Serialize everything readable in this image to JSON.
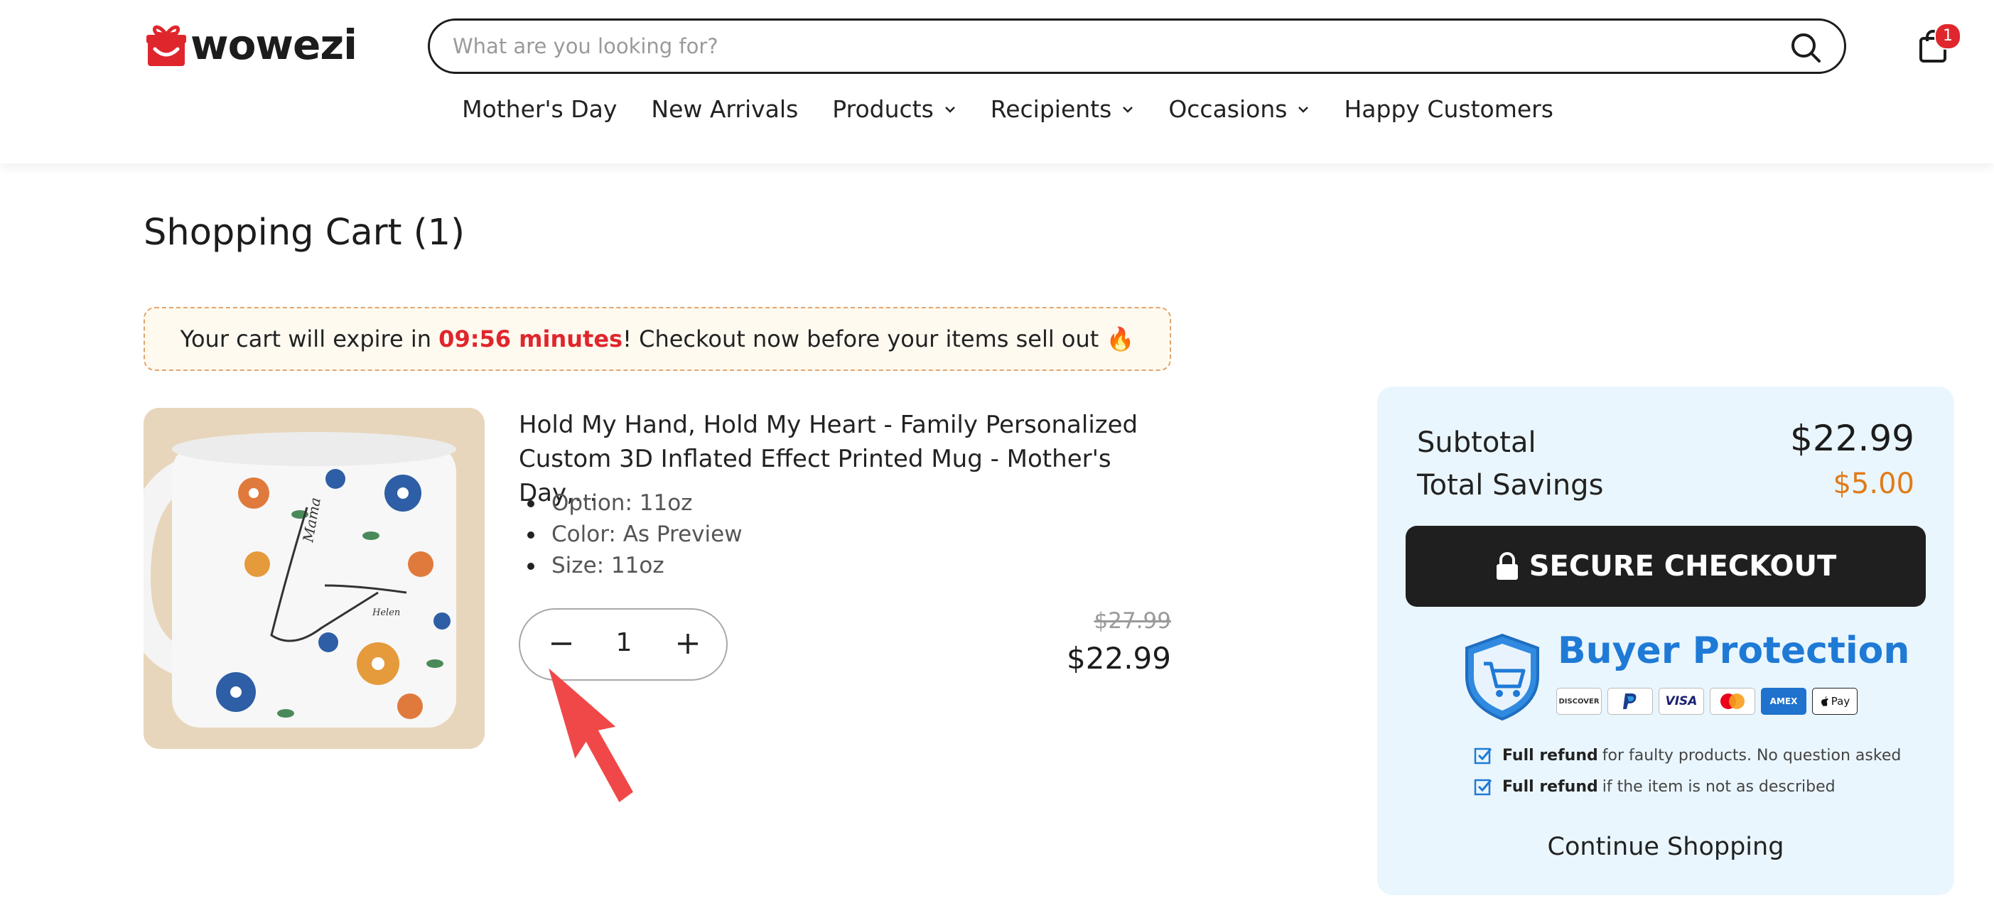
{
  "header": {
    "brand": "wowezi",
    "search_placeholder": "What are you looking for?",
    "cart_count": "1",
    "nav": [
      {
        "label": "Mother's Day",
        "dropdown": false
      },
      {
        "label": "New Arrivals",
        "dropdown": false
      },
      {
        "label": "Products",
        "dropdown": true
      },
      {
        "label": "Recipients",
        "dropdown": true
      },
      {
        "label": "Occasions",
        "dropdown": true
      },
      {
        "label": "Happy Customers",
        "dropdown": false
      }
    ]
  },
  "cart": {
    "title": "Shopping Cart (1)",
    "timer": {
      "prefix": "Your cart will expire in ",
      "time": "09:56 minutes",
      "suffix": "! Checkout now before your items sell out 🔥"
    },
    "item": {
      "title": "Hold My Hand, Hold My Heart - Family Personalized Custom 3D Inflated Effect Printed Mug - Mother's Day,...",
      "options": [
        "Option: 11oz",
        "Color: As Preview",
        "Size: 11oz"
      ],
      "quantity": "1",
      "price_original": "$27.99",
      "price": "$22.99",
      "mug_texts": [
        "Mama",
        "Helen"
      ]
    }
  },
  "summary": {
    "subtotal_label": "Subtotal",
    "subtotal": "$22.99",
    "savings_label": "Total Savings",
    "savings": "$5.00",
    "checkout_label": "SECURE CHECKOUT",
    "protection_title": "Buyer Protection",
    "payment_cards": [
      "DISCOVER",
      "PayPal",
      "VISA",
      "Mastercard",
      "AMEX",
      "Apple Pay"
    ],
    "guarantees": [
      {
        "bold": "Full refund",
        "text": "for faulty products. No question asked"
      },
      {
        "bold": "Full refund",
        "text": "if the item is not as described"
      }
    ],
    "continue_label": "Continue Shopping"
  },
  "colors": {
    "accent_red": "#e0262d",
    "savings_orange": "#e07b1a",
    "protection_blue": "#1f7ad6",
    "summary_bg": "#eaf6fd"
  }
}
